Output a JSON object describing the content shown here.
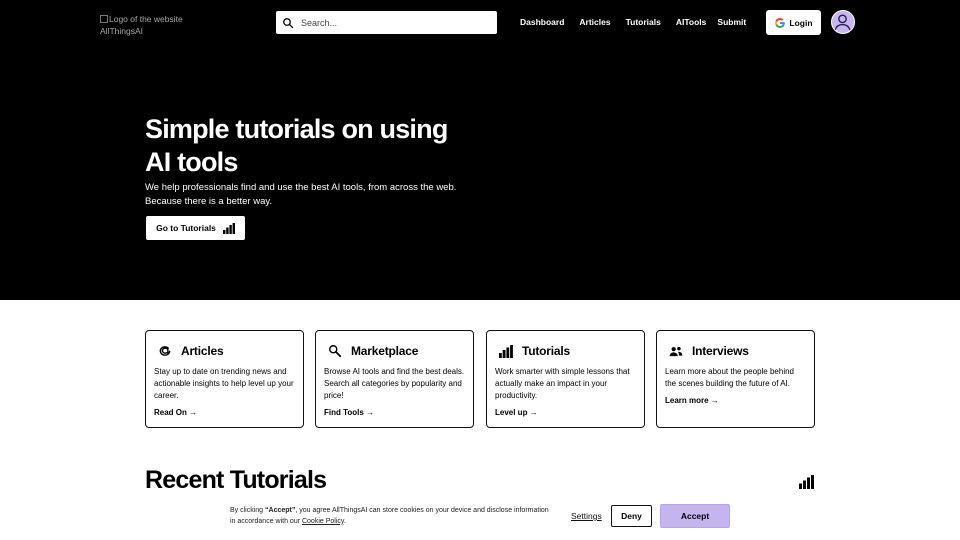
{
  "header": {
    "logo_alt": "Logo of the website AllThingsAI",
    "search_placeholder": "Search...",
    "nav": [
      "Dashboard",
      "Articles",
      "Tutorials",
      "AITools",
      "Submit"
    ],
    "login_label": "Login"
  },
  "hero": {
    "title": "Simple tutorials on using AI tools",
    "subtitle": "We help professionals find and use the best AI tools, from across the web. Because there is a better way.",
    "cta_label": "Go to Tutorials"
  },
  "cards": [
    {
      "title": "Articles",
      "icon": "paperclip-icon",
      "desc": "Stay up to date on trending news and actionable insights to help level up your career.",
      "link": "Read On →"
    },
    {
      "title": "Marketplace",
      "icon": "magnifier-icon",
      "desc": "Browse AI tools and find the best deals. Search all categories by popularity and price!",
      "link": "Find Tools →"
    },
    {
      "title": "Tutorials",
      "icon": "bar-chart-icon",
      "desc": "Work smarter with simple lessons that actually make an impact in your productivity.",
      "link": "Level up →"
    },
    {
      "title": "Interviews",
      "icon": "people-icon",
      "desc": "Learn more about the people behind the scenes building the future of AI.",
      "link": "Learn more →"
    }
  ],
  "recent": {
    "title": "Recent Tutorials"
  },
  "cookie": {
    "text_prefix": "By clicking ",
    "text_bold": "“Accept”",
    "text_middle": ", you agree AllThingsAI can store cookies on your device and disclose information in accordance with our ",
    "policy_link": "Cookie Policy",
    "text_suffix": ".",
    "settings_label": "Settings",
    "deny_label": "Deny",
    "accept_label": "Accept"
  },
  "colors": {
    "hero_bg": "#000000",
    "accent": "#c5b5ee"
  }
}
